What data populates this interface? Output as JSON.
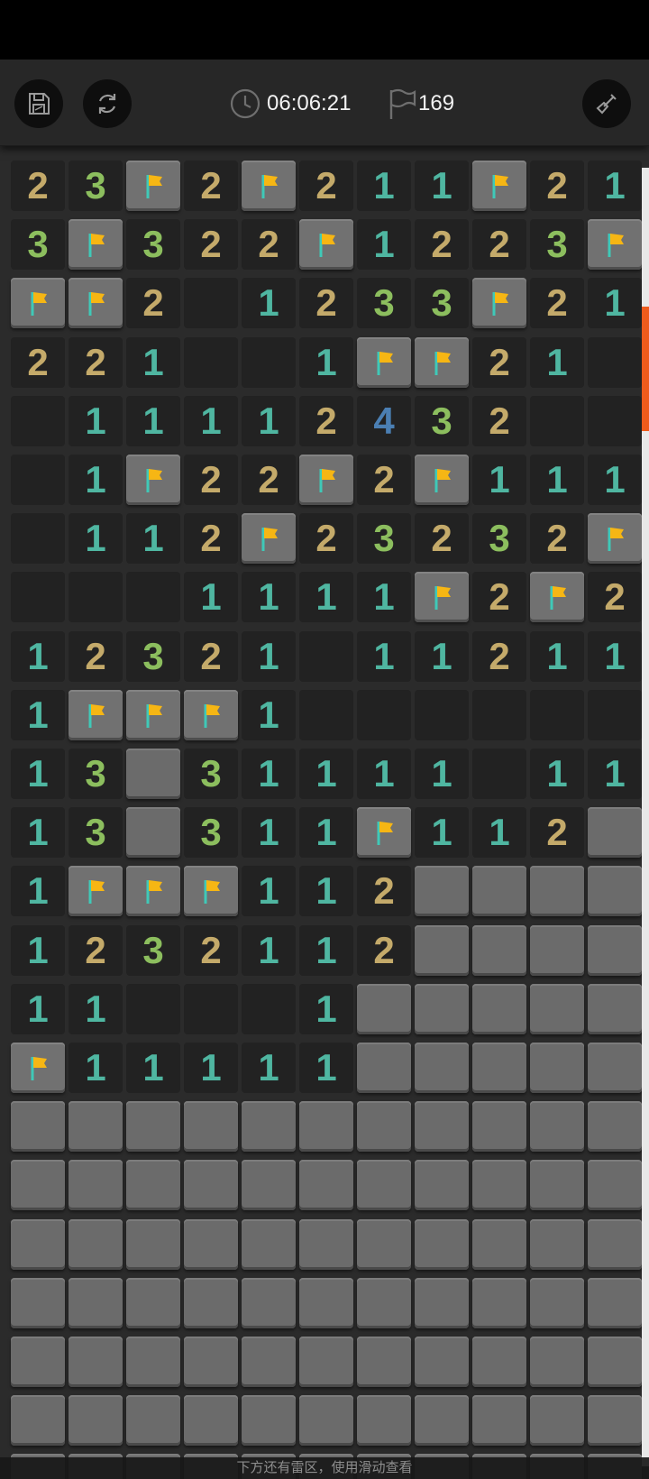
{
  "toolbar": {
    "save_icon": "save-icon",
    "restart_icon": "restart-icon",
    "clock_icon": "clock-icon",
    "timer": "06:06:21",
    "flag_icon": "flag-outline-icon",
    "flags_remaining": "169",
    "shovel_icon": "shovel-icon"
  },
  "board": {
    "columns": 11,
    "rows": [
      "23F2F211F21",
      "3F322F1223F",
      "FF2 1233F21",
      "221  1FF21 ",
      " 11112432  ",
      " 1F22F2F111",
      " 112F23232F",
      "   1111F2F2",
      "12321 11211",
      "1FFF1      ",
      "13#31111 11",
      "13#311F112#",
      "1FFF112####",
      "1232112####",
      "11   1#####",
      "F11111#####",
      "###########",
      "###########",
      "###########",
      "###########",
      "###########",
      "###########",
      "###########"
    ],
    "legend": {
      "F": "flag",
      "#": "covered",
      " ": "empty",
      "digit": "adjacent mine count"
    }
  },
  "colors": {
    "n1": "#4fb6a1",
    "n2": "#c4aa6a",
    "n3": "#8cbe5e",
    "n4": "#4b7fb3",
    "flag": "#f6b614",
    "accent": "#ee5b1c"
  },
  "hint": "下方还有雷区，使用滑动查看"
}
